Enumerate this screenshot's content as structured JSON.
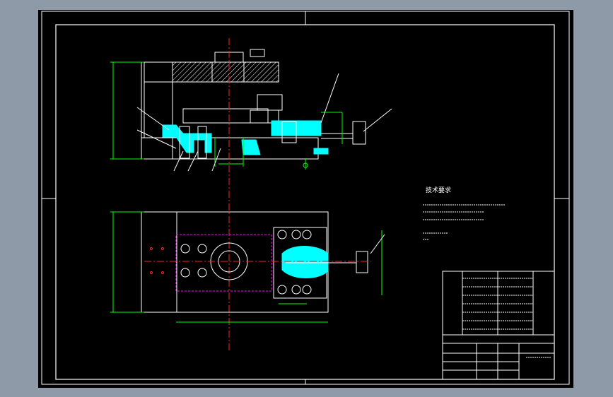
{
  "drawing": {
    "background": "#000000",
    "frame_color": "#ffffff",
    "dimension_color": "#00ff00",
    "hidden_line_color": "#ff00ff",
    "centerline_color": "#ff2020",
    "highlight_color": "#00ffff"
  },
  "notes": {
    "heading": "技术要求"
  }
}
